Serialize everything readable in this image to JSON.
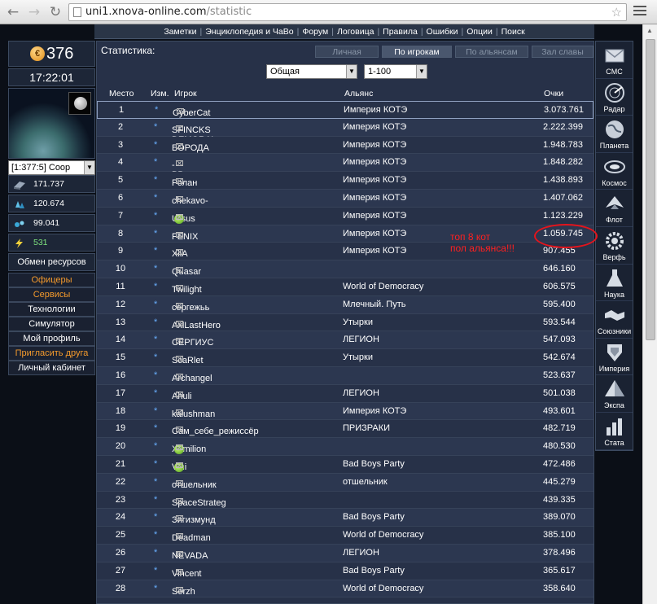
{
  "browser": {
    "url_host": "uni1.xnova-online.com",
    "url_path": "/statistic"
  },
  "topnav": [
    "Заметки",
    "Энциклопедия и ЧаВо",
    "Форум",
    "Логовица",
    "Правила",
    "Ошибки",
    "Опции",
    "Поиск"
  ],
  "left": {
    "credits": "376",
    "clock": "17:22:01",
    "coords": "[1:377:5] Coop",
    "resources": [
      {
        "icon": "metal-icon",
        "value": "171.737"
      },
      {
        "icon": "crystal-icon",
        "value": "120.674"
      },
      {
        "icon": "deuterium-icon",
        "value": "99.041"
      },
      {
        "icon": "energy-icon",
        "value": "531"
      }
    ],
    "exchange": "Обмен ресурсов",
    "menu": [
      {
        "label": "Офицеры",
        "color": "orange"
      },
      {
        "label": "Сервисы",
        "color": "orange"
      },
      {
        "label": "Технологии",
        "color": "white"
      },
      {
        "label": "Симулятор",
        "color": "white"
      },
      {
        "label": "Мой профиль",
        "color": "white"
      },
      {
        "label": "Пригласить друга",
        "color": "orange"
      },
      {
        "label": "Личный кабинет",
        "color": "white"
      }
    ]
  },
  "right": [
    {
      "label": "СМС",
      "icon": "envelope-icon"
    },
    {
      "label": "Радар",
      "icon": "radar-icon"
    },
    {
      "label": "Планета",
      "icon": "globe-icon"
    },
    {
      "label": "Космос",
      "icon": "galaxy-icon"
    },
    {
      "label": "Флот",
      "icon": "ship-icon"
    },
    {
      "label": "Верфь",
      "icon": "gear-icon"
    },
    {
      "label": "Наука",
      "icon": "flask-icon"
    },
    {
      "label": "Союзники",
      "icon": "handshake-icon"
    },
    {
      "label": "Империя",
      "icon": "shield-icon"
    },
    {
      "label": "Экспа",
      "icon": "pyramid-icon"
    },
    {
      "label": "Стата",
      "icon": "bar-chart-icon"
    }
  ],
  "main": {
    "title": "Статистика:",
    "tabs": [
      "Личная",
      "По игрокам",
      "По альянсам",
      "Зал славы"
    ],
    "type_select": "Общая",
    "range_select": "1-100",
    "columns": {
      "place": "Место",
      "change": "Изм.",
      "player": "Игрок",
      "alliance": "Альянс",
      "points": "Очки"
    },
    "rows": [
      {
        "place": "1",
        "change": "*",
        "name": "CyberCat",
        "badge": false,
        "alliance": "Империя КОТЭ",
        "points": "3.073.761"
      },
      {
        "place": "2",
        "change": "*",
        "name": "SFINCKS DEMORAL",
        "badge": false,
        "alliance": "Империя КОТЭ",
        "points": "2.222.399"
      },
      {
        "place": "3",
        "change": "*",
        "name": "БОРОДА",
        "badge": false,
        "alliance": "Империя КОТЭ",
        "points": "1.948.783"
      },
      {
        "place": "4",
        "change": "*",
        "name": "-BB-",
        "badge": false,
        "alliance": "Империя КОТЭ",
        "points": "1.848.282"
      },
      {
        "place": "5",
        "change": "*",
        "name": "Ролан",
        "badge": false,
        "alliance": "Империя КОТЭ",
        "points": "1.438.893"
      },
      {
        "place": "6",
        "change": "*",
        "name": "chekavo-_-",
        "badge": false,
        "alliance": "Империя КОТЭ",
        "points": "1.407.062"
      },
      {
        "place": "7",
        "change": "*",
        "name": "Ursus",
        "badge": true,
        "alliance": "Империя КОТЭ",
        "points": "1.123.229"
      },
      {
        "place": "8",
        "change": "*",
        "name": "FENIX",
        "badge": false,
        "alliance": "Империя КОТЭ",
        "points": "1.059.745"
      },
      {
        "place": "9",
        "change": "*",
        "name": "XiiA",
        "badge": false,
        "alliance": "Империя КОТЭ",
        "points": "907.455"
      },
      {
        "place": "10",
        "change": "*",
        "name": "Quasar",
        "badge": false,
        "alliance": "",
        "points": "646.160"
      },
      {
        "place": "11",
        "change": "*",
        "name": "Twilight",
        "badge": false,
        "alliance": "World of Democracy",
        "points": "606.575"
      },
      {
        "place": "12",
        "change": "*",
        "name": "сергежьь",
        "badge": false,
        "alliance": "Млечный. Путь",
        "points": "595.400"
      },
      {
        "place": "13",
        "change": "*",
        "name": "AxlLastHero",
        "badge": false,
        "alliance": "Утырки",
        "points": "593.544"
      },
      {
        "place": "14",
        "change": "*",
        "name": "СЕРГИУС",
        "badge": false,
        "alliance": "ЛЕГИОН",
        "points": "547.093"
      },
      {
        "place": "15",
        "change": "*",
        "name": "ScaRlet",
        "badge": false,
        "alliance": "Утырки",
        "points": "542.674"
      },
      {
        "place": "16",
        "change": "*",
        "name": "Archangel",
        "badge": false,
        "alliance": "",
        "points": "523.637"
      },
      {
        "place": "17",
        "change": "*",
        "name": "Ahuli",
        "badge": false,
        "alliance": "ЛЕГИОН",
        "points": "501.038"
      },
      {
        "place": "18",
        "change": "*",
        "name": "kalushman",
        "badge": false,
        "alliance": "Империя КОТЭ",
        "points": "493.601"
      },
      {
        "place": "19",
        "change": "*",
        "name": "Сам_себе_режиссёр",
        "badge": false,
        "alliance": "ПРИЗРАКИ",
        "points": "482.719"
      },
      {
        "place": "20",
        "change": "*",
        "name": "Xamilion",
        "badge": true,
        "alliance": "",
        "points": "480.530"
      },
      {
        "place": "21",
        "change": "*",
        "name": "Vini",
        "badge": true,
        "alliance": "Bad Boys Party",
        "points": "472.486"
      },
      {
        "place": "22",
        "change": "*",
        "name": "отшельник",
        "badge": false,
        "alliance": "отшельник",
        "points": "445.279"
      },
      {
        "place": "23",
        "change": "*",
        "name": "SpaceStrateg",
        "badge": false,
        "alliance": "",
        "points": "439.335"
      },
      {
        "place": "24",
        "change": "*",
        "name": "Зигизмунд",
        "badge": false,
        "alliance": "Bad Boys Party",
        "points": "389.070"
      },
      {
        "place": "25",
        "change": "*",
        "name": "Deadman",
        "badge": false,
        "alliance": "World of Democracy",
        "points": "385.100"
      },
      {
        "place": "26",
        "change": "*",
        "name": "NEVADA",
        "badge": false,
        "alliance": "ЛЕГИОН",
        "points": "378.496"
      },
      {
        "place": "27",
        "change": "*",
        "name": "Vincent",
        "badge": false,
        "alliance": "Bad Boys Party",
        "points": "365.617"
      },
      {
        "place": "28",
        "change": "*",
        "name": "Serzh",
        "badge": false,
        "alliance": "World of Democracy",
        "points": "358.640"
      }
    ]
  },
  "annotation": {
    "line1": "топ 8 кот",
    "line2": "пол альянса!!!",
    "color": "#ff2020"
  }
}
